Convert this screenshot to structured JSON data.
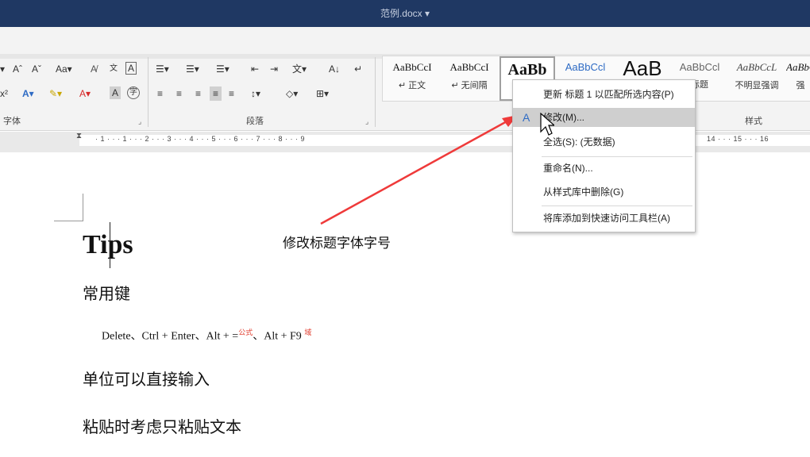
{
  "window": {
    "title": "范例.docx ▾"
  },
  "ribbon": {
    "font_group_label": "字体",
    "paragraph_group_label": "段落",
    "styles_group_label": "样式",
    "font_controls": {
      "grow_font": "Aˆ",
      "shrink_font": "Aˇ",
      "change_case": "Aa▾",
      "clear_format": "A̸",
      "phonetic": "文",
      "char_border": "A",
      "superscript": "x²",
      "text_effects": "A▾",
      "highlight": "✎▾",
      "font_color": "A▾",
      "char_shading": "A",
      "enclose_char": "字"
    },
    "paragraph_controls": {
      "bullets": "☰▾",
      "numbering": "☰▾",
      "multilevel": "☰▾",
      "decrease_indent": "⇤",
      "increase_indent": "⇥",
      "chinese_layout": "文▾",
      "sort": "A↓",
      "show_marks": "↵",
      "align_left": "≡",
      "align_center": "≡",
      "align_right": "≡",
      "justify": "≡",
      "distributed": "≡",
      "line_spacing": "↕▾",
      "shading": "◇▾",
      "borders": "⊞▾"
    },
    "styles": [
      {
        "sample": "AaBbCcI",
        "name": "↵ 正文"
      },
      {
        "sample": "AaBbCcI",
        "name": "↵ 无间隔"
      },
      {
        "sample": "AaBb",
        "name": ""
      },
      {
        "sample": "AaBbCcl",
        "name": ""
      },
      {
        "sample": "AaB",
        "name": ""
      },
      {
        "sample": "AaBbCcl",
        "name": "标题"
      },
      {
        "sample": "AaBbCcL",
        "name": "不明显强调"
      },
      {
        "sample": "AaBbCcL",
        "name": "强"
      }
    ]
  },
  "ruler": {
    "numbers": "· 1 · · · 1 · · · 2 · · · 3 · · · 4 · · · 5 · · · 6 · · · 7 · · · 8 · · · 9",
    "numbers_right": "14 · · · 15 · · · 16"
  },
  "context_menu": {
    "items": [
      {
        "label": "更新 标题 1 以匹配所选内容(P)"
      },
      {
        "label": "修改(M)..."
      },
      {
        "label": "全选(S): (无数据)"
      },
      {
        "label": "重命名(N)..."
      },
      {
        "label": "从样式库中删除(G)"
      },
      {
        "label": "将库添加到快速访问工具栏(A)"
      }
    ],
    "highlighted_index": 1
  },
  "document": {
    "heading": "Tips",
    "section1": "常用键",
    "keys_line": {
      "part1": "Delete、Ctrl + Enter、Alt + =",
      "sup1": "公式",
      "part2": "、Alt + F9 ",
      "sup2": "域"
    },
    "section2": "单位可以直接输入",
    "section3": "粘贴时考虑只粘贴文本"
  },
  "annotation": {
    "text": "修改标题字体字号",
    "arrow_color": "#ef3a3a"
  },
  "colors": {
    "titlebar": "#1f3863",
    "accent_red": "#e03a2b"
  }
}
